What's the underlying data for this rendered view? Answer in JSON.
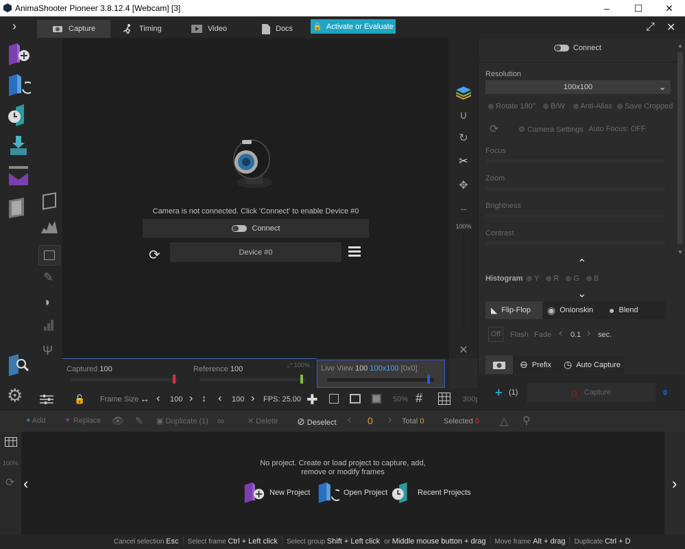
{
  "window": {
    "title": "AnimaShooter Pioneer 3.8.12.4 [Webcam] [3]"
  },
  "tabs": [
    {
      "label": "Capture"
    },
    {
      "label": "Timing"
    },
    {
      "label": "Video"
    },
    {
      "label": "Docs"
    }
  ],
  "activate_label": "Activate or Evaluate",
  "preview": {
    "message": "Camera is not connected. Click 'Connect' to enable Device #0",
    "connect_label": "Connect",
    "device_label": "Device #0"
  },
  "right_strip": {
    "zoom": "100%"
  },
  "panels": {
    "captured_label": "Captured",
    "captured_value": "100",
    "reference_label": "Reference",
    "reference_value": "100",
    "reference_opacity": "100%",
    "liveview_label": "Live View",
    "liveview_value": "100",
    "liveview_res": "100x100",
    "liveview_offset": "[0x0]"
  },
  "bottom": {
    "frame_size_label": "Frame Size",
    "width": "100",
    "height": "100",
    "fps": "FPS: 25.00",
    "percent": "50%",
    "dpi": "300p"
  },
  "right_panel": {
    "connect_label": "Connect",
    "resolution_label": "Resolution",
    "resolution_value": "100x100",
    "options": [
      "Rotate 180°",
      "B/W",
      "Anti-Alias",
      "Save Cropped"
    ],
    "camera_settings": "Camera Settings",
    "auto_focus": "Auto Focus: OFF",
    "sliders": [
      "Focus",
      "Zoom",
      "Brightness",
      "Contrast"
    ],
    "histogram_label": "Histogram",
    "histogram_channels": [
      "Y",
      "R",
      "G",
      "B"
    ],
    "flip_tabs": [
      "Flip-Flop",
      "Onionskin",
      "Blend"
    ],
    "flip_off": "Off",
    "flip_flash": "Flash",
    "flip_fade": "Fade",
    "flip_value": "0.1",
    "flip_unit": "sec.",
    "capture_tabs": [
      "Prefix",
      "Auto Capture"
    ],
    "capture_count": "(1)",
    "capture_label": "Capture",
    "capture_badge": "0"
  },
  "actions": {
    "add": "Add",
    "replace": "Replace",
    "duplicate": "Duplicate (1)",
    "delete": "Delete",
    "deselect": "Deselect",
    "frame_index": "0",
    "total_label": "Total",
    "total_value": "0",
    "selected_label": "Selected",
    "selected_value": "0"
  },
  "timeline": {
    "zoom": "100%",
    "empty_line1": "No project. Create or load project to capture, add,",
    "empty_line2": "remove or modify frames",
    "new_project": "New Project",
    "open_project": "Open Project",
    "recent_projects": "Recent Projects"
  },
  "status": [
    {
      "desc": "Cancel selection",
      "key": "Esc"
    },
    {
      "desc": "Select frame",
      "key": "Ctrl + Left click"
    },
    {
      "desc": "Select group",
      "key": "Shift + Left click"
    },
    {
      "desc": "or",
      "key": "Middle mouse button + drag"
    },
    {
      "desc": "Move frame",
      "key": "Alt + drag"
    },
    {
      "desc": "Duplicate",
      "key": "Ctrl + D"
    }
  ],
  "colors": {
    "accent": "#1fa5c4",
    "captured_marker": "#d8323c",
    "reference_marker": "#7ac143",
    "liveview_marker": "#2a5ad8",
    "highlight": "#4aa3e8",
    "total_orange": "#e0a040",
    "selected_red": "#e03030"
  }
}
